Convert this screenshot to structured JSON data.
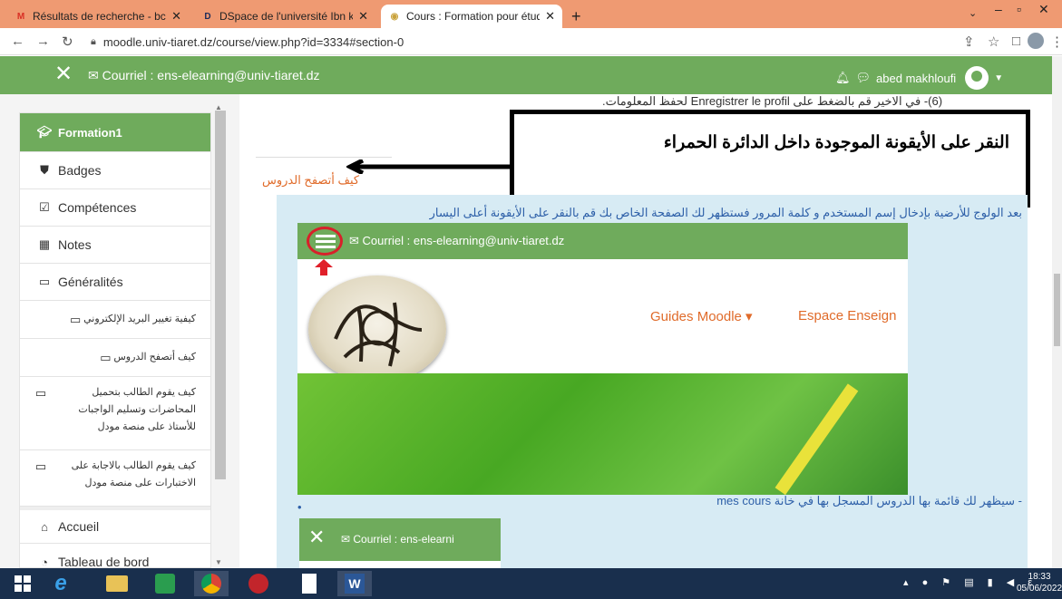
{
  "browser": {
    "tabs": [
      {
        "title": "Résultats de recherche - bc.assist",
        "icon": "gmail-icon"
      },
      {
        "title": "DSpace de l'université Ibn khaldou",
        "icon": "dspace-icon"
      },
      {
        "title": "Cours : Formation pour étudiant",
        "icon": "moodle-icon",
        "active": true
      }
    ],
    "url": "moodle.univ-tiaret.dz/course/view.php?id=3334#section-0"
  },
  "moodle_header": {
    "email": "Courriel : ens-elearning@univ-tiaret.dz",
    "user_name": "abed makhloufi"
  },
  "sidebar": {
    "course": "Formation1",
    "items": [
      {
        "label": "Badges",
        "icon": "shield-icon"
      },
      {
        "label": "Compétences",
        "icon": "checkbox-icon"
      },
      {
        "label": "Notes",
        "icon": "table-icon"
      },
      {
        "label": "Généralités",
        "icon": "folder-icon"
      },
      {
        "label": "كيفية تغيير البريد الإلكتروني",
        "icon": "folder-icon"
      },
      {
        "label": "كيف أتصفح الدروس",
        "icon": "folder-icon"
      },
      {
        "label": "كيف يقوم الطالب بتحميل المحاضرات وتسليم الواجبات للأستاذ على منصة مودل",
        "icon": "folder-icon"
      },
      {
        "label": "كيف يقوم الطالب بالاجابة على الاختبارات على منصة مودل",
        "icon": "folder-icon"
      },
      {
        "label": "Accueil",
        "icon": "home-icon"
      },
      {
        "label": "Tableau de bord",
        "icon": "dashboard-icon"
      }
    ]
  },
  "content": {
    "top_text": "(6)- في الاخير قم بالضغط على Enregistrer le profil لحفظ المعلومات.",
    "annotation": "النقر على الأيقونة الموجودة داخل الدائرة الحمراء",
    "section_title": "كيف أتصفح الدروس",
    "instruction": "بعد الولوج للأرضية بإدخال إسم المستخدم و كلمة المرور فستظهر لك الصفحة الخاص بك قم بالنقر على الأيقونة أعلى اليسار",
    "embedded_email": "Courriel : ens-elearning@univ-tiaret.dz",
    "embedded_nav": [
      "Guides Moodle ▾",
      "Espace Enseign"
    ],
    "instruction2": "- سيظهر لك قائمة بها الدروس المسجل بها في خانة mes cours",
    "bullet": "•",
    "embedded2_email": "Courriel : ens-elearni"
  },
  "taskbar": {
    "time": "18:33",
    "date": "05/06/2022"
  }
}
